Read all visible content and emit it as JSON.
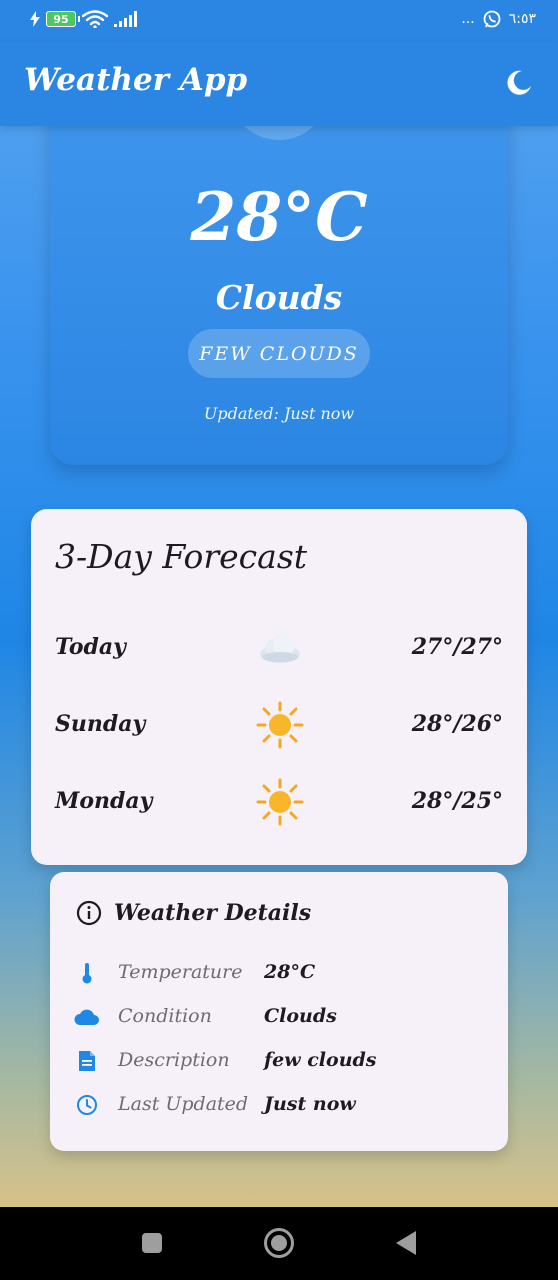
{
  "status_bar": {
    "battery": "95",
    "time": "٦:٥٣",
    "more": "..."
  },
  "app_bar": {
    "title": "Weather App",
    "toggle_icon": "moon-icon"
  },
  "current": {
    "temperature": "28°C",
    "condition": "Clouds",
    "description": "FEW CLOUDS",
    "updated": "Updated: Just now"
  },
  "forecast": {
    "title": "3-Day Forecast",
    "days": [
      {
        "day": "Today",
        "icon": "cloud-icon",
        "temps": "27°/27°"
      },
      {
        "day": "Sunday",
        "icon": "sun-icon",
        "temps": "28°/26°"
      },
      {
        "day": "Monday",
        "icon": "sun-icon",
        "temps": "28°/25°"
      }
    ]
  },
  "details": {
    "title": "Weather Details",
    "rows": [
      {
        "label": "Temperature",
        "value": "28°C",
        "icon": "thermometer-icon"
      },
      {
        "label": "Condition",
        "value": "Clouds",
        "icon": "cloud-icon"
      },
      {
        "label": "Description",
        "value": "few clouds",
        "icon": "document-icon"
      },
      {
        "label": "Last Updated",
        "value": "Just now",
        "icon": "clock-icon"
      }
    ]
  },
  "colors": {
    "primary": "#2b86e3",
    "accent_icon": "#1e88e5",
    "card_bg": "#f6f1f8"
  }
}
